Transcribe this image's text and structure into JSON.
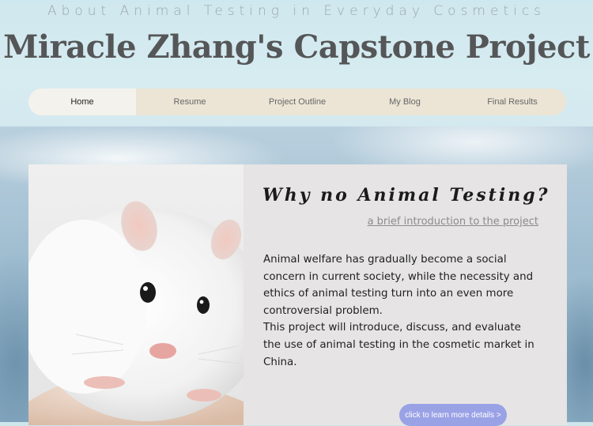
{
  "header": {
    "subtitle": "About Animal Testing in Everyday Cosmetics",
    "title": "Miracle Zhang's Capstone Project"
  },
  "nav": {
    "items": [
      {
        "label": "Home",
        "active": true
      },
      {
        "label": "Resume",
        "active": false
      },
      {
        "label": "Project Outline",
        "active": false
      },
      {
        "label": "My Blog",
        "active": false
      },
      {
        "label": "Final Results",
        "active": false
      }
    ]
  },
  "main": {
    "card_title": "Why no Animal Testing?",
    "card_link": "a brief introduction to the project",
    "paragraphs": [
      "Animal welfare has gradually become a social concern in current society, while the necessity and ethics of animal testing turn into an even more controversial problem.",
      "This project will introduce, discuss, and evaluate the use of animal testing in the cosmetic market in China."
    ],
    "cta_label": "click to learn more details >"
  },
  "colors": {
    "nav_bg": "#ece5d6",
    "nav_active_bg": "#f4f2ec",
    "card_bg": "#e6e4e4",
    "cta_bg": "#9aa2e6",
    "title_color": "#555657"
  }
}
